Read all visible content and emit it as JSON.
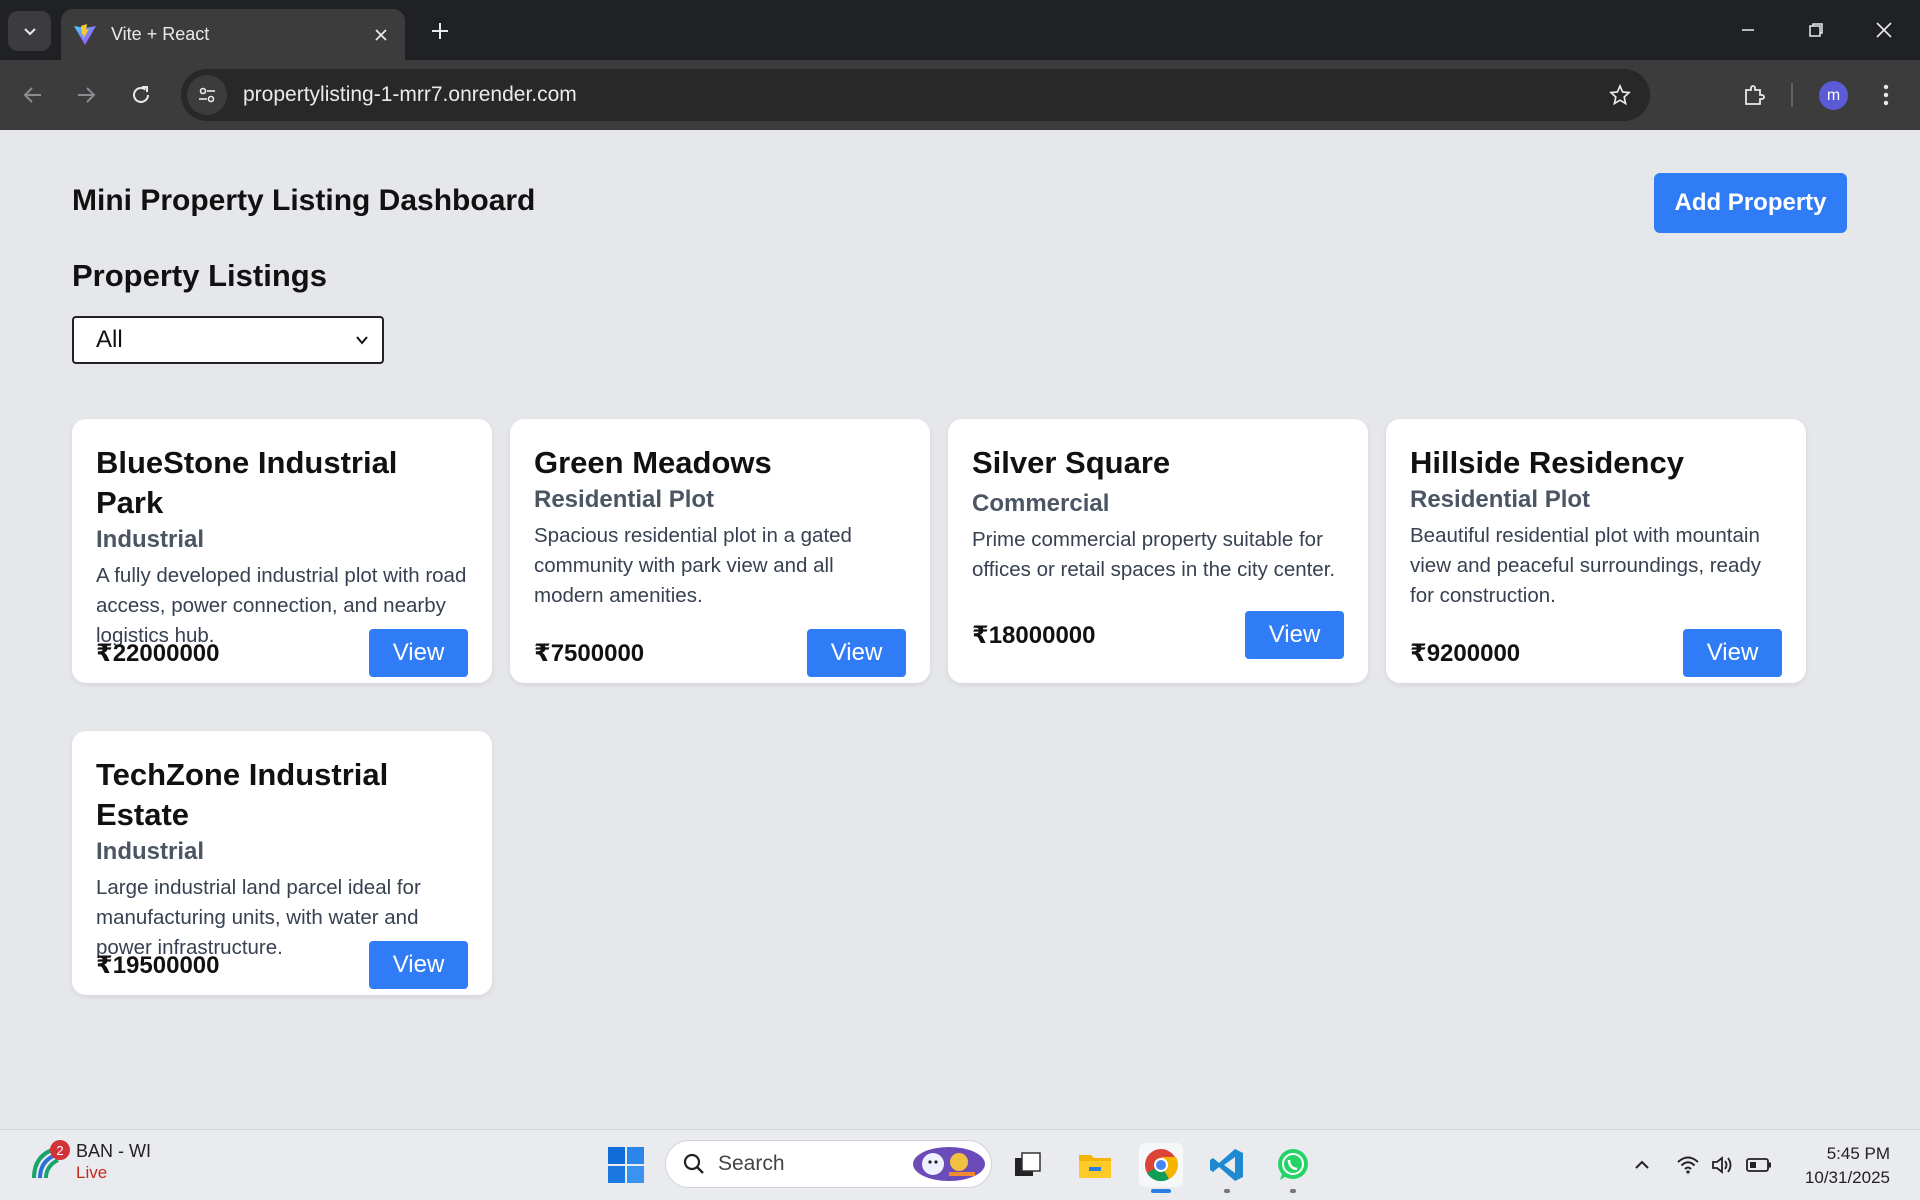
{
  "browser": {
    "tab_title": "Vite + React",
    "url": "propertylisting-1-mrr7.onrender.com",
    "profile_initial": "m"
  },
  "page": {
    "title": "Mini Property Listing Dashboard",
    "add_button": "Add Property",
    "section_title": "Property Listings",
    "filter_value": "All"
  },
  "properties": [
    {
      "title": "BlueStone Industrial Park",
      "type": "Industrial",
      "description": "A fully developed industrial plot with road access, power connection, and nearby logistics hub.",
      "price": "₹22000000",
      "action": "View"
    },
    {
      "title": "Green Meadows",
      "type": "Residential Plot",
      "description": "Spacious residential plot in a gated community with park view and all modern amenities.",
      "price": "₹7500000",
      "action": "View"
    },
    {
      "title": "Silver Square",
      "type": "Commercial",
      "description": "Prime commercial property suitable for offices or retail spaces in the city center.",
      "price": "₹18000000",
      "action": "View"
    },
    {
      "title": "Hillside Residency",
      "type": "Residential Plot",
      "description": "Beautiful residential plot with mountain view and peaceful surroundings, ready for construction.",
      "price": "₹9200000",
      "action": "View"
    },
    {
      "title": "TechZone Industrial Estate",
      "type": "Industrial",
      "description": "Large industrial land parcel ideal for manufacturing units, with water and power infrastructure.",
      "price": "₹19500000",
      "action": "View"
    }
  ],
  "taskbar": {
    "weather_line1": "BAN - WI",
    "weather_line2": "Live",
    "notification_count": "2",
    "search_placeholder": "Search",
    "time": "5:45 PM",
    "date": "10/31/2025"
  },
  "colors": {
    "accent": "#2f7cf6",
    "page_bg": "#e5e7eb",
    "chrome_dark": "#202124"
  }
}
